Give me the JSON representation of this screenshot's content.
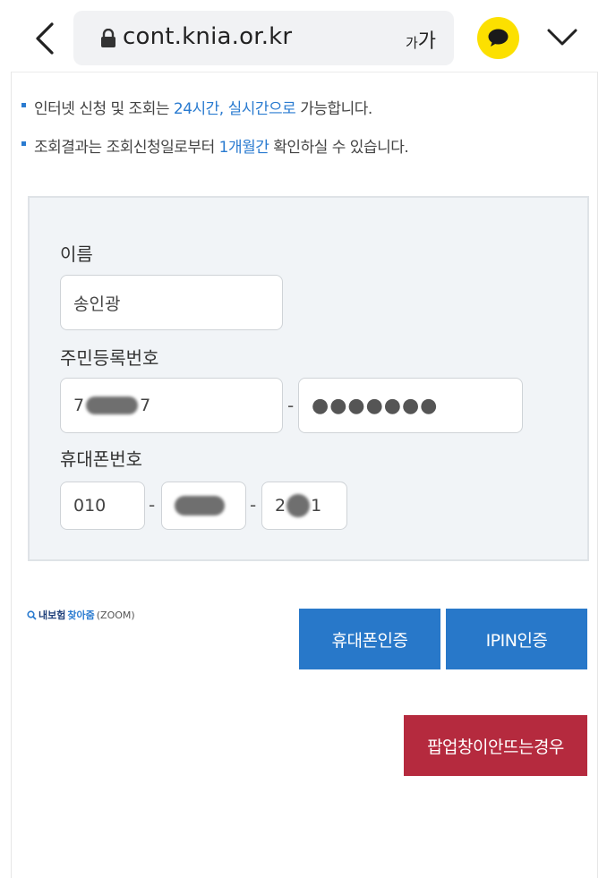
{
  "browser": {
    "url": "cont.knia.or.kr",
    "font_size_label_small": "가",
    "font_size_label_large": "가",
    "icons": [
      "back-arrow-icon",
      "lock-icon",
      "kakao-chat-icon",
      "chevron-down-icon"
    ],
    "kakao_color": "#fce000"
  },
  "notices": {
    "line1_before": "인터넷 신청 및 조회는 ",
    "line1_highlight": "24시간, 실시간으로",
    "line1_after": " 가능합니다.",
    "line2_before": "조회결과는 조회신청일로부터 ",
    "line2_highlight": "1개월간",
    "line2_after": " 확인하실 수 있습니다.",
    "highlight_color": "#2a7bd0"
  },
  "form": {
    "name_label": "이름",
    "name_value": "송인광",
    "rrn_label": "주민등록번호",
    "rrn_front_start": "7",
    "rrn_front_end": "7",
    "rrn_dash": "-",
    "rrn_back_masked": "●●●●●●●",
    "phone_label": "휴대폰번호",
    "phone_part1": "010",
    "phone_part2": "",
    "phone_part3_start": "2",
    "phone_part3_end": "1",
    "phone_dash": "-"
  },
  "zoom_link": {
    "part1": "내보험",
    "part2": " 찾아줌",
    "part3": "(ZOOM)"
  },
  "buttons": {
    "phone_auth": "휴대폰인증",
    "ipin_auth": "IPIN인증",
    "popup_help": "팝업창이안뜨는경우",
    "primary_color": "#2878c9",
    "danger_color": "#b52a3e"
  }
}
